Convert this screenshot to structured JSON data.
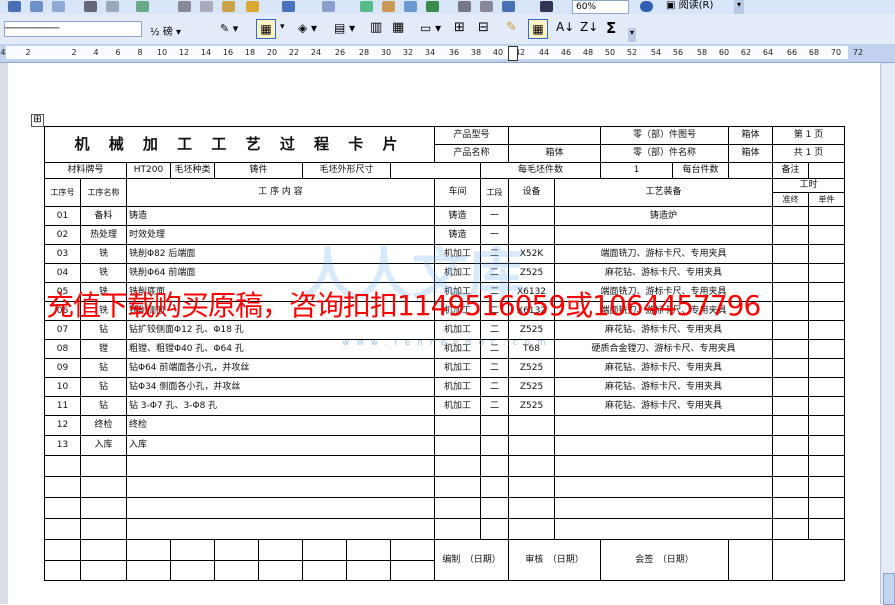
{
  "toolbar": {
    "style_preview": "──────────",
    "weight_label": "½ 磅",
    "zoom": "60%",
    "reading_mode": "阅读(R)"
  },
  "ruler": {
    "ticks": [
      "4",
      "2",
      "2",
      "4",
      "6",
      "8",
      "10",
      "12",
      "14",
      "16",
      "18",
      "20",
      "22",
      "24",
      "26",
      "28",
      "30",
      "32",
      "34",
      "36",
      "38",
      "40",
      "42",
      "44",
      "46",
      "48",
      "50",
      "52",
      "54",
      "56",
      "58",
      "60",
      "62",
      "64",
      "66",
      "68",
      "70",
      "72"
    ]
  },
  "card": {
    "title": "机 械 加 工 工 艺 过 程 卡 片",
    "product_model_label": "产品型号",
    "product_name_label": "产品名称",
    "part_no_label": "零（部）件图号",
    "part_name_label": "零（部）件名称",
    "box_label": "箱体",
    "box_value": "箱体",
    "box_label2": "箱体",
    "page_no": "第 1 页",
    "page_total": "共 1 页",
    "material_label": "材料牌号",
    "material_value": "HT200",
    "blank_kind_label": "毛坯种类",
    "blank_kind_value": "铸件",
    "blank_size_label": "毛坯外形尺寸",
    "blanks_per_label": "每毛坯件数",
    "blanks_per_value": "1",
    "per_unit_label": "每台件数",
    "remark_label": "备注",
    "hdr": {
      "seq": "工序号",
      "name": "工序名称",
      "content": "工 序 内 容",
      "workshop": "车间",
      "section": "工段",
      "equipment": "设备",
      "tooling": "工艺装备",
      "time": "工时",
      "prep": "准终",
      "unit": "单件"
    },
    "rows": [
      {
        "seq": "01",
        "name": "备料",
        "content": "铸造",
        "ws": "铸造",
        "sec": "一",
        "eq": "",
        "tool": "铸造炉"
      },
      {
        "seq": "02",
        "name": "热处理",
        "content": "时效处理",
        "ws": "铸造",
        "sec": "一",
        "eq": "",
        "tool": ""
      },
      {
        "seq": "03",
        "name": "铣",
        "content": "铣削Φ82 后端面",
        "ws": "机加工",
        "sec": "二",
        "eq": "X52K",
        "tool": "端面铣刀、游标卡尺、专用夹具"
      },
      {
        "seq": "04",
        "name": "铣",
        "content": "铣削Φ64 前端面",
        "ws": "机加工",
        "sec": "二",
        "eq": "Z525",
        "tool": "麻花钻、游标卡尺、专用夹具"
      },
      {
        "seq": "05",
        "name": "铣",
        "content": "铣削底面",
        "ws": "机加工",
        "sec": "二",
        "eq": "X6132",
        "tool": "端面铣刀、游标卡尺、专用夹具"
      },
      {
        "seq": "06",
        "name": "铣",
        "content": "铣削侧面",
        "ws": "机加工",
        "sec": "二",
        "eq": "X6132",
        "tool": "端面铣刀、游标卡尺、专用夹具"
      },
      {
        "seq": "07",
        "name": "钻",
        "content": "钻扩铰侧面Φ12 孔、Φ18 孔",
        "ws": "机加工",
        "sec": "二",
        "eq": "Z525",
        "tool": "麻花钻、游标卡尺、专用夹具"
      },
      {
        "seq": "08",
        "name": "镗",
        "content": "粗镗、粗镗Φ40 孔、Φ64 孔",
        "ws": "机加工",
        "sec": "二",
        "eq": "T68",
        "tool": "硬质合金镗刀、游标卡尺、专用夹具"
      },
      {
        "seq": "09",
        "name": "钻",
        "content": "钻Φ64 前端面各小孔，并攻丝",
        "ws": "机加工",
        "sec": "二",
        "eq": "Z525",
        "tool": "麻花钻、游标卡尺、专用夹具"
      },
      {
        "seq": "10",
        "name": "钻",
        "content": "钻Φ34 侧面各小孔，并攻丝",
        "ws": "机加工",
        "sec": "二",
        "eq": "Z525",
        "tool": "麻花钻、游标卡尺、专用夹具"
      },
      {
        "seq": "11",
        "name": "钻",
        "content": "钻 3-Φ7 孔、3-Φ8 孔",
        "ws": "机加工",
        "sec": "二",
        "eq": "Z525",
        "tool": "麻花钻、游标卡尺、专用夹具"
      },
      {
        "seq": "12",
        "name": "终检",
        "content": "终检",
        "ws": "",
        "sec": "",
        "eq": "",
        "tool": ""
      },
      {
        "seq": "13",
        "name": "入库",
        "content": "入库",
        "ws": "",
        "sec": "",
        "eq": "",
        "tool": ""
      }
    ],
    "sign_design": "编制　（日期）",
    "sign_review": "审核　（日期）",
    "sign_countersign": "会签　（日期）"
  },
  "watermark": {
    "text": "充值下载购买原稿，咨询扣扣1149516059或1064457796",
    "logo": "人人文库",
    "url": "www.renrendoc.com"
  }
}
